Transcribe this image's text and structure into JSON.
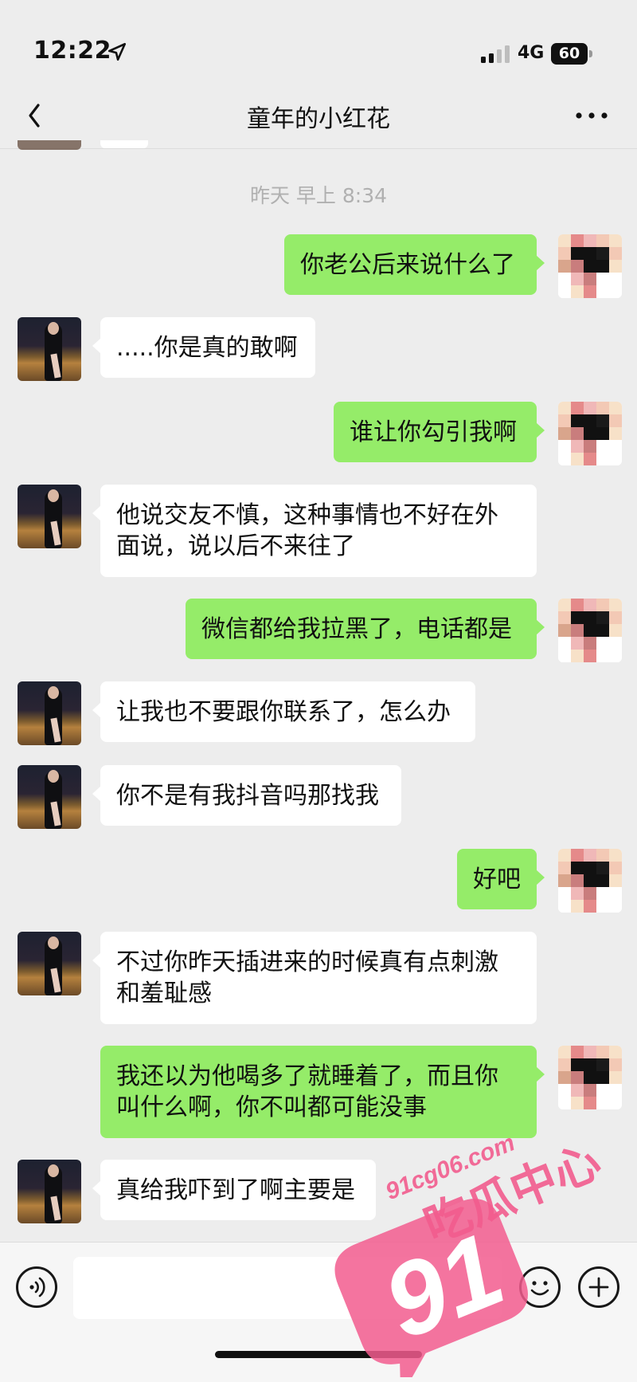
{
  "status_bar": {
    "time": "12:22",
    "network": "4G",
    "battery": "60"
  },
  "header": {
    "title": "童年的小红花"
  },
  "chat": {
    "timestamp": "昨天 早上 8:34",
    "messages": [
      {
        "side": "right",
        "text": "你老公后来说什么了"
      },
      {
        "side": "left",
        "text": ".....你是真的敢啊"
      },
      {
        "side": "right",
        "text": "谁让你勾引我啊"
      },
      {
        "side": "left",
        "text": "他说交友不慎，这种事情也不好在外面说，说以后不来往了"
      },
      {
        "side": "right",
        "text": "微信都给我拉黑了，电话都是"
      },
      {
        "side": "left",
        "text": "让我也不要跟你联系了，怎么办"
      },
      {
        "side": "left",
        "text": "你不是有我抖音吗那找我"
      },
      {
        "side": "right",
        "text": "好吧"
      },
      {
        "side": "left",
        "text": "不过你昨天插进来的时候真有点刺激和羞耻感"
      },
      {
        "side": "right",
        "text": "我还以为他喝多了就睡着了，而且你叫什么啊，你不叫都可能没事"
      },
      {
        "side": "left",
        "text": "真给我吓到了啊主要是"
      }
    ]
  },
  "input_bar": {
    "placeholder": ""
  },
  "watermark": {
    "number": "91",
    "domain": "91cg06.com",
    "brand": "吃瓜中心"
  },
  "colors": {
    "background": "#ededed",
    "bubble_sent": "#95ec69",
    "bubble_received": "#ffffff",
    "timestamp": "#b0b0b0",
    "watermark": "#f25c8e"
  },
  "icons": {
    "back": "chevron-left-icon",
    "more": "more-dots-icon",
    "voice": "voice-icon",
    "emoji": "emoji-icon",
    "plus": "plus-icon",
    "location": "location-arrow-icon"
  }
}
